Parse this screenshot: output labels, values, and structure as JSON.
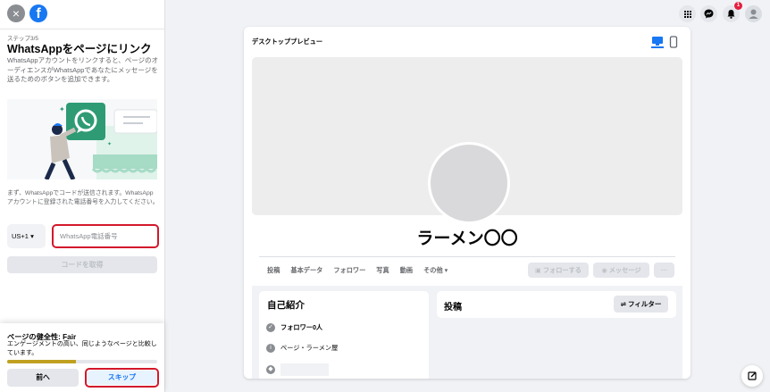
{
  "left_panel": {
    "close_icon": "×",
    "logo": "f",
    "step": "ステップ3/5",
    "title": "WhatsAppをページにリンク",
    "description": "WhatsAppアカウントをリンクすると、ページのオーディエンスがWhatsAppであなたにメッセージを送るためのボタンを追加できます。",
    "note": "まず、WhatsAppでコードが送信されます。WhatsAppアカウントに登録された電話番号を入力してください。",
    "country_code": "US+1",
    "phone_placeholder": "WhatsApp電話番号",
    "get_code_label": "コードを取得",
    "health_title": "ページの健全性: Fair",
    "health_desc": "エンゲージメントの高い、同じようなページと比較しています。",
    "health_progress": 0.46,
    "prev_label": "前へ",
    "skip_label": "スキップ"
  },
  "topbar": {
    "icons": [
      "grid-icon",
      "messenger-icon",
      "bell-icon",
      "profile-icon"
    ],
    "notification_count": "1"
  },
  "preview": {
    "label": "デスクトッププレビュー",
    "page_name": "ラーメン〇〇",
    "tabs": [
      "投稿",
      "基本データ",
      "フォロワー",
      "写真",
      "動画",
      "その他 ▾"
    ],
    "follow_button": "フォローする",
    "message_button": "メッセージ",
    "more_button": "···",
    "intro_title": "自己紹介",
    "followers_text": "フォロワー0人",
    "page_category_text": "ページ・ラーメン屋",
    "posts_title": "投稿",
    "filter_label": "フィルター"
  },
  "colors": {
    "accent": "#1877f2",
    "highlight": "#d3182b",
    "progress": "#c0a020"
  }
}
